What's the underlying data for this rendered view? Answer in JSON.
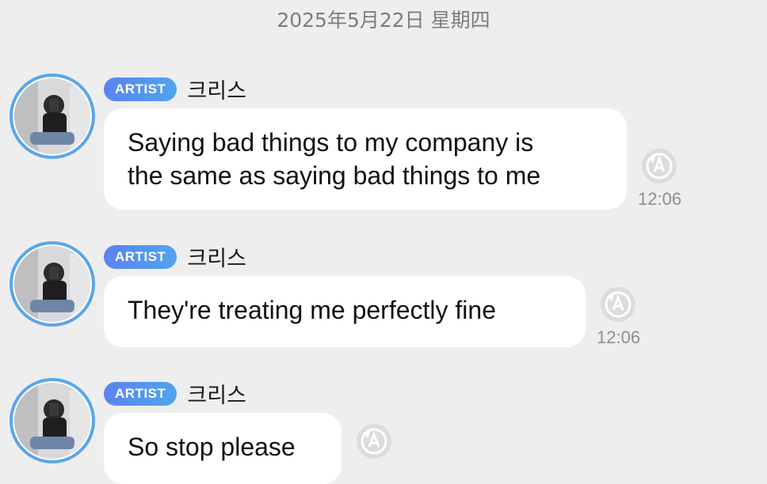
{
  "date_header": "2025年5月22日 星期四",
  "messages": [
    {
      "badge": "ARTIST",
      "sender": "크리스",
      "text": "Saying bad things to my company is\nthe same as saying bad things to me",
      "time": "12:06",
      "status_icon": "a-circle-icon"
    },
    {
      "badge": "ARTIST",
      "sender": "크리스",
      "text": "They're treating me perfectly fine",
      "time": "12:06",
      "status_icon": "a-circle-icon"
    },
    {
      "badge": "ARTIST",
      "sender": "크리스",
      "text": "So stop please",
      "time": "",
      "status_icon": "a-circle-icon"
    }
  ],
  "colors": {
    "background": "#eeeeef",
    "badge_start": "#5b83f0",
    "badge_end": "#4fa5ee",
    "bubble": "#ffffff",
    "avatar_ring": "#5aa6e8"
  }
}
